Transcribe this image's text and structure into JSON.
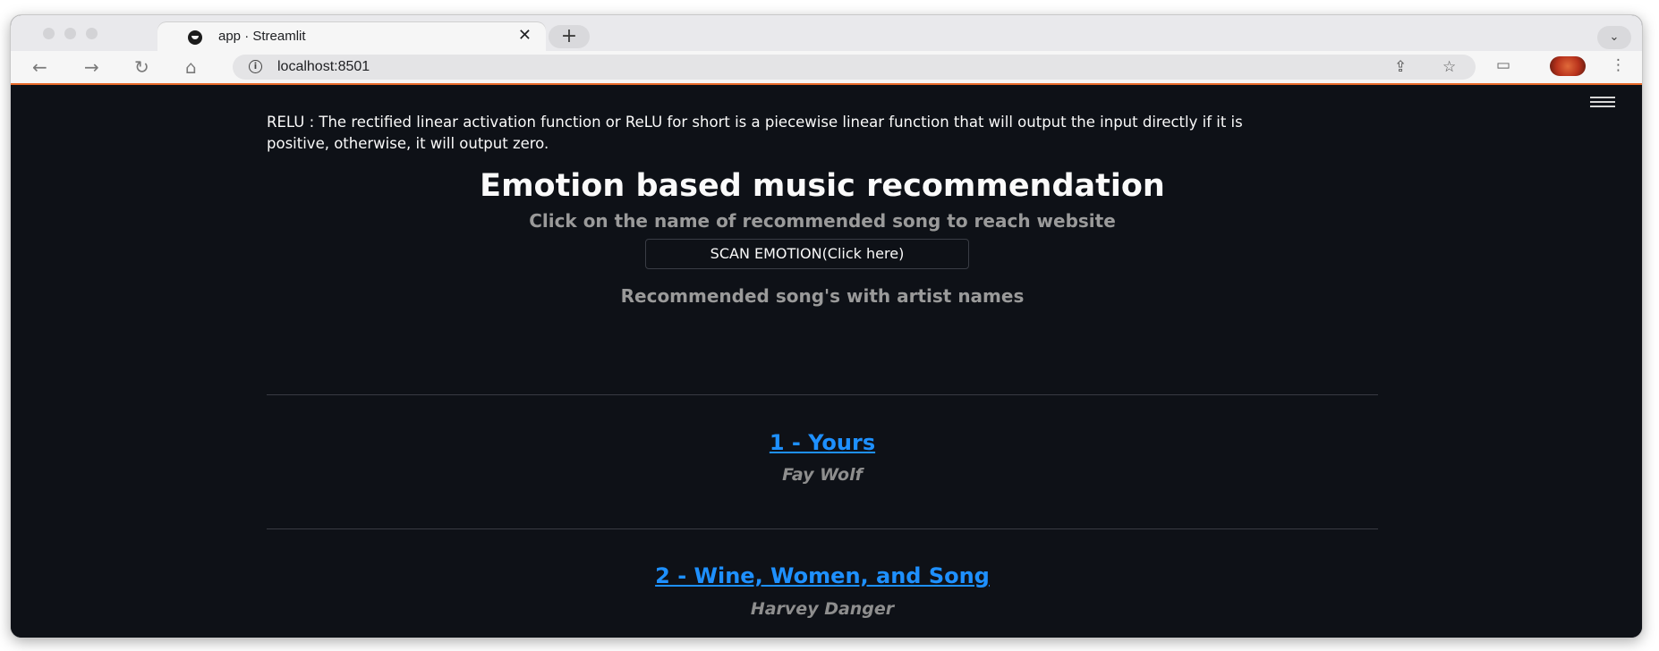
{
  "browser": {
    "tab_title": "app · Streamlit",
    "tab_close": "✕",
    "new_tab": "+",
    "tab_menu": "⌄",
    "url": "localhost:8501",
    "nav": {
      "back": "←",
      "forward": "→",
      "reload": "↻",
      "home": "⌂"
    },
    "icons": {
      "share": "⇪",
      "bookmark": "☆",
      "sidebar": "▭",
      "menu": "⋮"
    }
  },
  "page": {
    "relu_text": "RELU : The rectified linear activation function or ReLU for short is a piecewise linear function that will output the input directly if it is positive, otherwise, it will output zero.",
    "title": "Emotion based music recommendation",
    "subtitle": "Click on the name of recommended song to reach website",
    "scan_button": "SCAN EMOTION(Click here)",
    "recommendations_heading": "Recommended song's with artist names",
    "songs": [
      {
        "title": "1 - Yours",
        "artist": "Fay Wolf"
      },
      {
        "title": "2 - Wine, Women, and Song",
        "artist": "Harvey Danger"
      }
    ]
  },
  "colors": {
    "background": "#0e1117",
    "link": "#1e90ff",
    "muted_text": "#9a9a9a"
  }
}
